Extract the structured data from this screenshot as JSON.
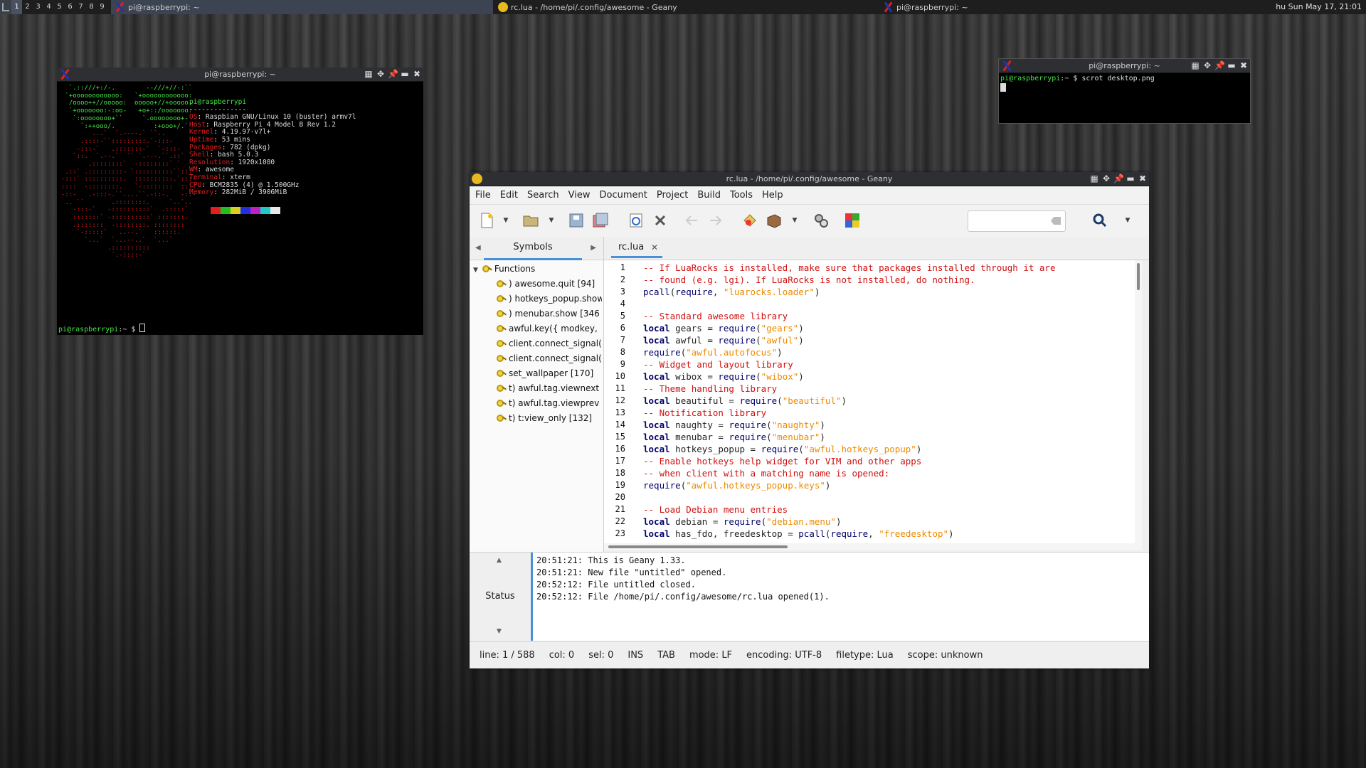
{
  "wibar": {
    "tags": [
      "1",
      "2",
      "3",
      "4",
      "5",
      "6",
      "7",
      "8",
      "9"
    ],
    "active_tag": "1",
    "tasks": [
      {
        "label": "pi@raspberrypi: ~",
        "icon": "xterm-x-icon"
      },
      {
        "label": "rc.lua - /home/pi/.config/awesome - Geany",
        "icon": "geany-icon"
      },
      {
        "label": "pi@raspberrypi: ~",
        "icon": "xterm-x-icon"
      }
    ],
    "clock": "hu  Sun May 17, 21:01"
  },
  "terminal1": {
    "title": "pi@raspberrypi: ~",
    "userhost": "pi@raspberrypi",
    "separator": "--------------",
    "info": [
      {
        "key": "OS",
        "value": "Raspbian GNU/Linux 10 (buster) armv7l"
      },
      {
        "key": "Host",
        "value": "Raspberry Pi 4 Model B Rev 1.2"
      },
      {
        "key": "Kernel",
        "value": "4.19.97-v7l+"
      },
      {
        "key": "Uptime",
        "value": "53 mins"
      },
      {
        "key": "Packages",
        "value": "782 (dpkg)"
      },
      {
        "key": "Shell",
        "value": "bash 5.0.3"
      },
      {
        "key": "Resolution",
        "value": "1920x1080"
      },
      {
        "key": "WM",
        "value": "awesome"
      },
      {
        "key": "Terminal",
        "value": "xterm"
      },
      {
        "key": "CPU",
        "value": "BCM2835 (4) @ 1.500GHz"
      },
      {
        "key": "Memory",
        "value": "282MiB / 3906MiB"
      }
    ],
    "palette": [
      "#000000",
      "#e02020",
      "#20c020",
      "#d8d020",
      "#2030e0",
      "#c020c0",
      "#20c8c8",
      "#e8e8e8"
    ],
    "prompt_user": "pi@raspberrypi",
    "prompt_rest": ":~ $ "
  },
  "terminal2": {
    "title": "pi@raspberrypi: ~",
    "prompt_user": "pi@raspberrypi",
    "prompt_rest": ":~ $ ",
    "command": "scrot desktop.png"
  },
  "geany": {
    "title": "rc.lua - /home/pi/.config/awesome - Geany",
    "menu": [
      "File",
      "Edit",
      "Search",
      "View",
      "Document",
      "Project",
      "Build",
      "Tools",
      "Help"
    ],
    "sidebar_tab": "Symbols",
    "tree_root": "Functions",
    "symbols": [
      ") awesome.quit [94]",
      ") hotkeys_popup.show",
      ") menubar.show [346",
      "awful.key({ modkey,",
      "client.connect_signal(",
      "client.connect_signal(",
      "set_wallpaper [170]",
      "t) awful.tag.viewnext",
      "t) awful.tag.viewprev",
      "t) t:view_only [132]"
    ],
    "editor_tab": "rc.lua",
    "messages_label": "Status",
    "messages": [
      "20:51:21: This is Geany 1.33.",
      "20:51:21: New file \"untitled\" opened.",
      "20:52:12: File untitled closed.",
      "20:52:12: File /home/pi/.config/awesome/rc.lua opened(1)."
    ],
    "status": [
      "line: 1 / 588",
      "col: 0",
      "sel: 0",
      "INS",
      "TAB",
      "mode: LF",
      "encoding: UTF-8",
      "filetype: Lua",
      "scope: unknown"
    ]
  }
}
